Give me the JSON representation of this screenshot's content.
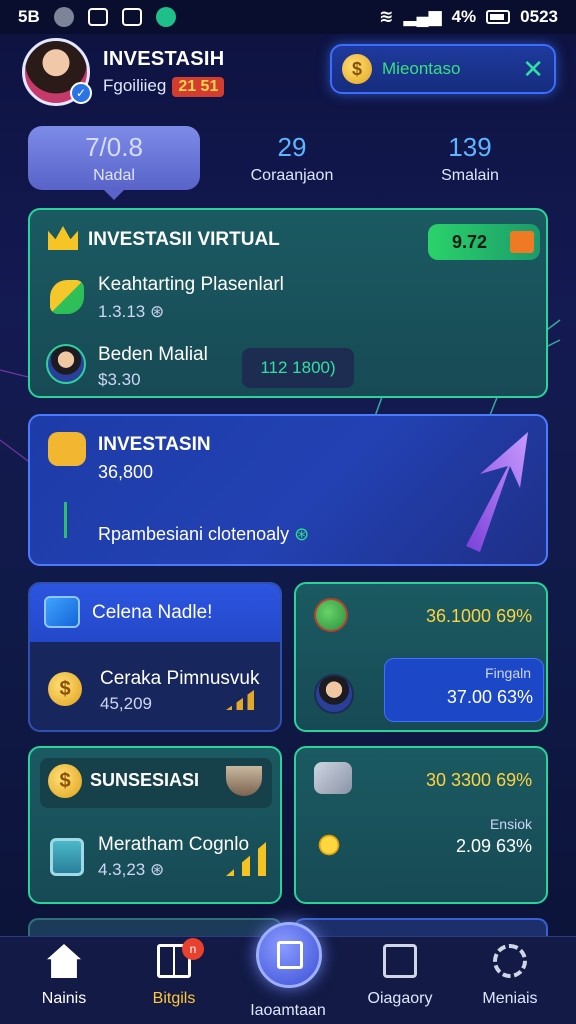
{
  "status": {
    "left_text": "5B",
    "time": "0523",
    "battery": "4%"
  },
  "header": {
    "name": "INVESTASIH",
    "level_label": "Fgoiliieg",
    "level_value": "21 51",
    "wallet_label": "Mieontaso",
    "wallet_coin": "$"
  },
  "stats": [
    {
      "value": "7/0.8",
      "label": "Nadal"
    },
    {
      "value": "29",
      "label": "Coraanjaon"
    },
    {
      "value": "139",
      "label": "Smalain"
    }
  ],
  "card_virtual": {
    "title": "INVESTASII VIRTUAL",
    "chip": "9.72",
    "row1_label": "Keahtarting Plasenlarl",
    "row1_value": "1.3.13",
    "row2_label": "Beden Malial",
    "row2_value": "$3.30",
    "row2_figure": "112 1800)"
  },
  "card_investasin": {
    "title": "INVESTASIN",
    "value": "36,800",
    "subtitle": "Rpambesiani clotenoaly"
  },
  "card_celena": {
    "title": "Celena Nadle!",
    "label": "Ceraka Pimnusvuk",
    "value": "45,209"
  },
  "card_right1": {
    "value": "36.1000 69%",
    "label": "Fingaln",
    "value2": "37.00 63%"
  },
  "card_sunsesiasi": {
    "title": "SUNSESIASI",
    "label": "Meratham Cognlo",
    "value": "4.3,23"
  },
  "card_right2": {
    "value": "30 3300 69%",
    "label": "Ensiok",
    "value2": "2.09 63%"
  },
  "nav": {
    "items": [
      {
        "label": "Nainis",
        "icon": "home-icon"
      },
      {
        "label": "Bitgils",
        "icon": "book-icon",
        "badge": "n"
      },
      {
        "label": "Iaoamtaan",
        "icon": "edit-icon"
      },
      {
        "label": "Oiagaory",
        "icon": "check-icon"
      },
      {
        "label": "Meniais",
        "icon": "gear-icon"
      }
    ]
  },
  "colors": {
    "accent_green": "#2bd39a",
    "accent_blue": "#4a7bff",
    "gold": "#ffd33d"
  }
}
